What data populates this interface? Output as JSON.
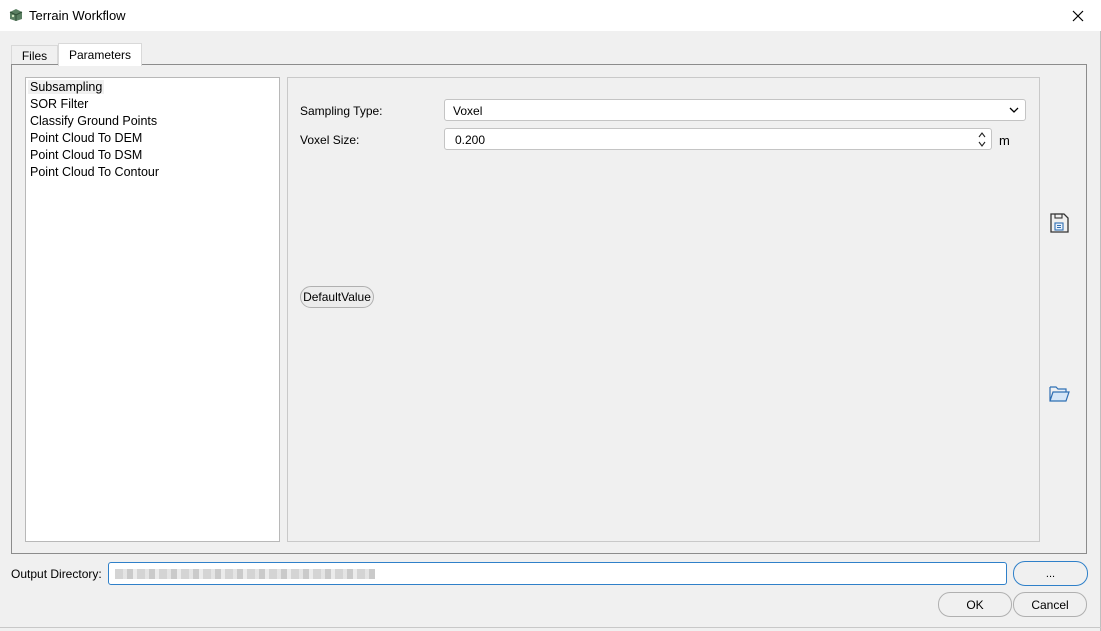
{
  "window": {
    "title": "Terrain Workflow"
  },
  "tabs": [
    {
      "label": "Files",
      "active": false
    },
    {
      "label": "Parameters",
      "active": true
    }
  ],
  "algorithms": [
    {
      "label": "Subsampling",
      "selected": true
    },
    {
      "label": "SOR Filter",
      "selected": false
    },
    {
      "label": "Classify Ground Points",
      "selected": false
    },
    {
      "label": "Point Cloud To DEM",
      "selected": false
    },
    {
      "label": "Point Cloud To DSM",
      "selected": false
    },
    {
      "label": "Point Cloud To Contour",
      "selected": false
    }
  ],
  "params": {
    "sampling_type_label": "Sampling Type:",
    "sampling_type_value": "Voxel",
    "voxel_size_label": "Voxel Size:",
    "voxel_size_value": "0.200",
    "voxel_unit": "m",
    "default_button": "DefaultValue"
  },
  "side_icons": {
    "save": "save-icon",
    "open": "folder-open-icon"
  },
  "output": {
    "label": "Output Directory:",
    "value": "",
    "browse_label": "..."
  },
  "buttons": {
    "ok": "OK",
    "cancel": "Cancel"
  },
  "colors": {
    "focus": "#2f80c9",
    "panel": "#f0f0f0",
    "list_bg": "#ffffff"
  }
}
